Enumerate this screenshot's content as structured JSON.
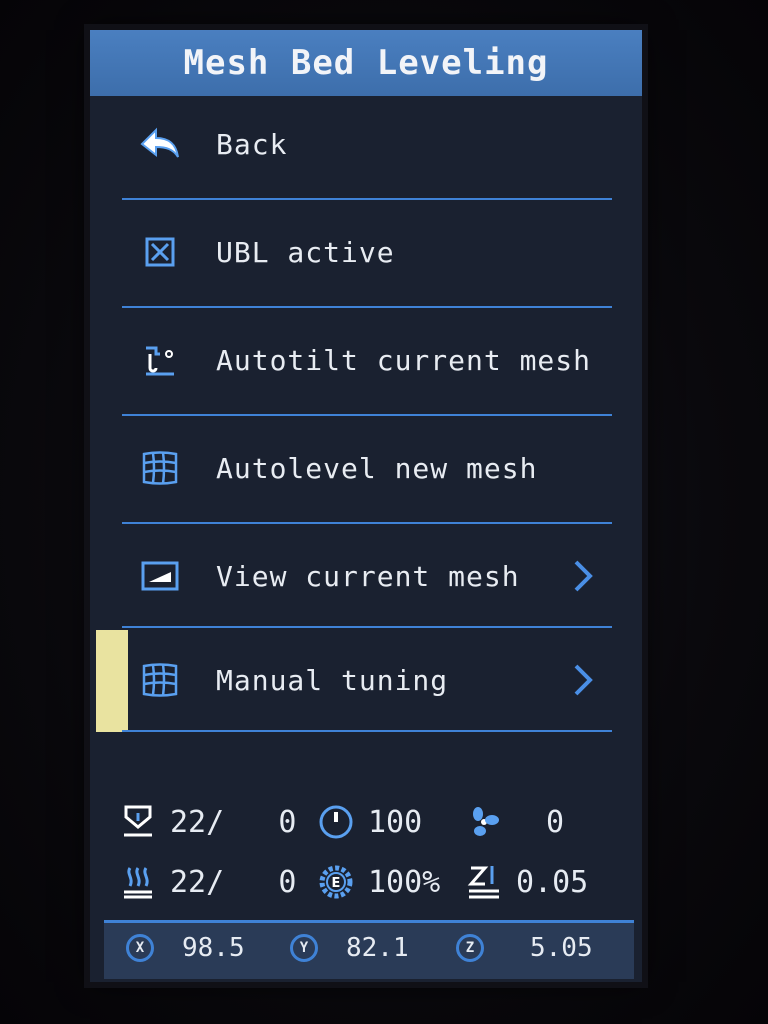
{
  "header": {
    "title": "Mesh Bed Leveling"
  },
  "menu": {
    "items": [
      {
        "label": "Back",
        "icon": "back-arrow-icon"
      },
      {
        "label": "UBL active",
        "icon": "checkbox-checked-icon"
      },
      {
        "label": "Autotilt current mesh",
        "icon": "probe-tilt-icon"
      },
      {
        "label": "Autolevel new mesh",
        "icon": "mesh-grid-icon"
      },
      {
        "label": "View current mesh",
        "icon": "view-mesh-icon",
        "chevron": "chevron-right-icon"
      },
      {
        "label": "Manual tuning",
        "icon": "mesh-grid-icon",
        "chevron": "chevron-right-icon",
        "selected": true
      }
    ]
  },
  "status": {
    "hotend_temp": "22/   0",
    "feedrate": "100",
    "fan": "0",
    "bed_temp": "22/   0",
    "flow": "100%",
    "z_offset": "0.05"
  },
  "axes": {
    "x_label": "X",
    "x": "98.5",
    "y_label": "Y",
    "y": "82.1",
    "z_label": "Z",
    "z": "5.05"
  },
  "colors": {
    "accent": "#3f82d6",
    "title_bar": "#4a7fc0",
    "background": "#1a2130",
    "selection": "#e9e3a0"
  }
}
